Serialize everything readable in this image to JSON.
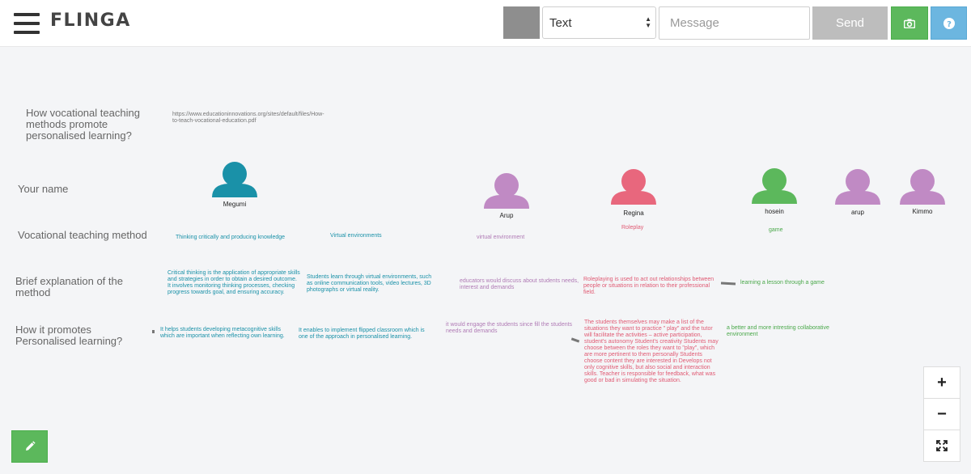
{
  "app": {
    "logo": "FLINGA",
    "menu_icon": "hamburger-menu-icon"
  },
  "toolbar": {
    "color_swatch": "#8e8e8e",
    "type_select_value": "Text",
    "message_placeholder": "Message",
    "send_label": "Send",
    "camera_icon": "camera-icon",
    "help_icon": "question-icon",
    "send_color": "#bdbdbd",
    "camera_color": "#5cb85c",
    "help_color": "#6cb6e0"
  },
  "board": {
    "row_labels": {
      "question": "How vocational teaching methods promote personalised learning?",
      "name": "Your name",
      "method": "Vocational teaching method",
      "explanation": "Brief explanation of the method",
      "promotes": "How it promotes Personalised learning?"
    },
    "reference_url": "https://www.educationinnovations.org/sites/default/files/How-to-teach-vocational-education.pdf",
    "participants": [
      {
        "name": "Megumi",
        "color": "#1a91a8"
      },
      {
        "name": "Arup",
        "color": "#c08ac4"
      },
      {
        "name": "Regina",
        "color": "#e8677d"
      },
      {
        "name": "hosein",
        "color": "#5cb85c"
      },
      {
        "name": "arup",
        "color": "#c08ac4"
      },
      {
        "name": "Kimmo",
        "color": "#c08ac4"
      }
    ],
    "methods": [
      {
        "text": "Thinking critically and producing knowledge",
        "color": "#1a91a8"
      },
      {
        "text": "Virtual environments",
        "color": "#1a91a8"
      },
      {
        "text": "virtual environment",
        "color": "#b07bb5"
      },
      {
        "text": "Roleplay",
        "color": "#e05a73"
      },
      {
        "text": "game",
        "color": "#4aa84a"
      }
    ],
    "explanations": [
      {
        "text": "Critical thinking is the application of appropriate skills and strategies in order to obtain a desired outcome. It involves monitoring thinking processes, checking progress towards goal, and ensuring accuracy.",
        "color": "#1a91a8"
      },
      {
        "text": "Students learn through virtual environments, such as online communication tools, video lectures, 3D photographs or virtual reality.",
        "color": "#1a91a8"
      },
      {
        "text": "educators would discuss about students needs, interest and demands",
        "color": "#b07bb5"
      },
      {
        "text": "Roleplaying is used to act out relationships between people or situations in relation to their professional field.",
        "color": "#e05a73"
      },
      {
        "text": "learning a lesson through a game",
        "color": "#4aa84a"
      }
    ],
    "promotes": [
      {
        "text": "It helps students developing metacognitive skills which are important when reflecting own learning.",
        "color": "#1a91a8"
      },
      {
        "text": "It enables to implement flipped classroom which is one of the approach in personalised learning.",
        "color": "#1a91a8"
      },
      {
        "text": "it would engage the students since fill the students needs and demands",
        "color": "#b07bb5"
      },
      {
        "text": "The students themselves may make a list of the situations they want to practice \" play\" and the tutor will facilitate the activities – active participation, student's autonomy Student's creativity Students may choose between the roles they want to \"play\", which are more pertinent to them personally Students choose content they are interested in Develops not only cognitive skills, but also social and interaction skills. Teacher is responsible for feedback, what was good or bad in simulating the situation.",
        "color": "#e05a73"
      },
      {
        "text": "a better and more intresting collaborative environment",
        "color": "#4aa84a"
      }
    ]
  },
  "controls": {
    "zoom_in_label": "+",
    "zoom_out_label": "−",
    "fullscreen_icon": "expand-icon",
    "edit_icon": "pencil-icon"
  }
}
